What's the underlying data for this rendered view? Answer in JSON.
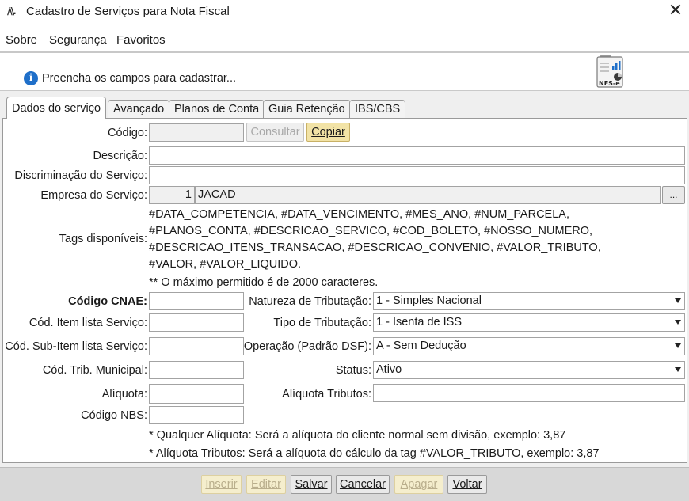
{
  "window": {
    "title": "Cadastro de Serviços para Nota Fiscal"
  },
  "menu": {
    "items": [
      "Sobre",
      "Segurança",
      "Favoritos"
    ]
  },
  "info": {
    "message": "Preencha os campos para cadastrar...",
    "badge": "NFS-e"
  },
  "tabs": [
    {
      "label": "Dados do serviço",
      "active": true
    },
    {
      "label": "Avançado",
      "active": false
    },
    {
      "label": "Planos de Conta",
      "active": false
    },
    {
      "label": "Guia Retenção",
      "active": false
    },
    {
      "label": "IBS/CBS",
      "active": false
    }
  ],
  "form": {
    "codigo": {
      "label": "Código:",
      "value": "",
      "consultar_label": "Consultar",
      "copiar_label": "Copiar"
    },
    "descricao": {
      "label": "Descrição:",
      "value": ""
    },
    "discriminacao": {
      "label": "Discriminação do Serviço:",
      "value": ""
    },
    "empresa": {
      "label": "Empresa do Serviço:",
      "code": "1",
      "name": "JACAD",
      "browse_label": "..."
    },
    "tags": {
      "label": "Tags disponíveis:",
      "lines": [
        "#DATA_COMPETENCIA, #DATA_VENCIMENTO, #MES_ANO, #NUM_PARCELA,",
        "#PLANOS_CONTA, #DESCRICAO_SERVICO, #COD_BOLETO, #NOSSO_NUMERO,",
        "#DESCRICAO_ITENS_TRANSACAO, #DESCRICAO_CONVENIO, #VALOR_TRIBUTO,",
        "#VALOR, #VALOR_LIQUIDO."
      ],
      "max_note": "** O máximo permitido é de 2000 caracteres."
    },
    "codigo_cnae": {
      "label": "Código CNAE:",
      "value": ""
    },
    "cod_item_lista": {
      "label": "Cód. Item lista Serviço:",
      "value": ""
    },
    "cod_subitem_lista": {
      "label": "Cód. Sub-Item lista Serviço:",
      "value": ""
    },
    "cod_trib_municipal": {
      "label": "Cód. Trib. Municipal:",
      "value": ""
    },
    "aliquota": {
      "label": "Alíquota:",
      "value": ""
    },
    "codigo_nbs": {
      "label": "Código NBS:",
      "value": ""
    },
    "natureza_tributacao": {
      "label": "Natureza de Tributação:",
      "value": "1 - Simples Nacional"
    },
    "tipo_tributacao": {
      "label": "Tipo de Tributação:",
      "value": "1 - Isenta de ISS"
    },
    "operacao": {
      "label": "Operação (Padrão DSF):",
      "value": "A - Sem Dedução"
    },
    "status": {
      "label": "Status:",
      "value": "Ativo"
    },
    "aliquota_tributos": {
      "label": "Alíquota Tributos:",
      "value": ""
    },
    "notes": [
      "* Qualquer Alíquota: Será a alíquota do cliente normal sem divisão, exemplo: 3,87",
      "* Alíquota Tributos: Será a alíquota do cálculo da tag #VALOR_TRIBUTO, exemplo: 3,87"
    ]
  },
  "actions": {
    "inserir": "Inserir",
    "editar": "Editar",
    "salvar": "Salvar",
    "cancelar": "Cancelar",
    "apagar": "Apagar",
    "voltar": "Voltar"
  },
  "colors": {
    "info_blue": "#1f6fc9",
    "accent_yellow": "#f2e3a6"
  },
  "icons": [
    "app-logo-icon",
    "close-icon",
    "info-icon",
    "nfse-document-icon",
    "chevron-down-icon"
  ]
}
